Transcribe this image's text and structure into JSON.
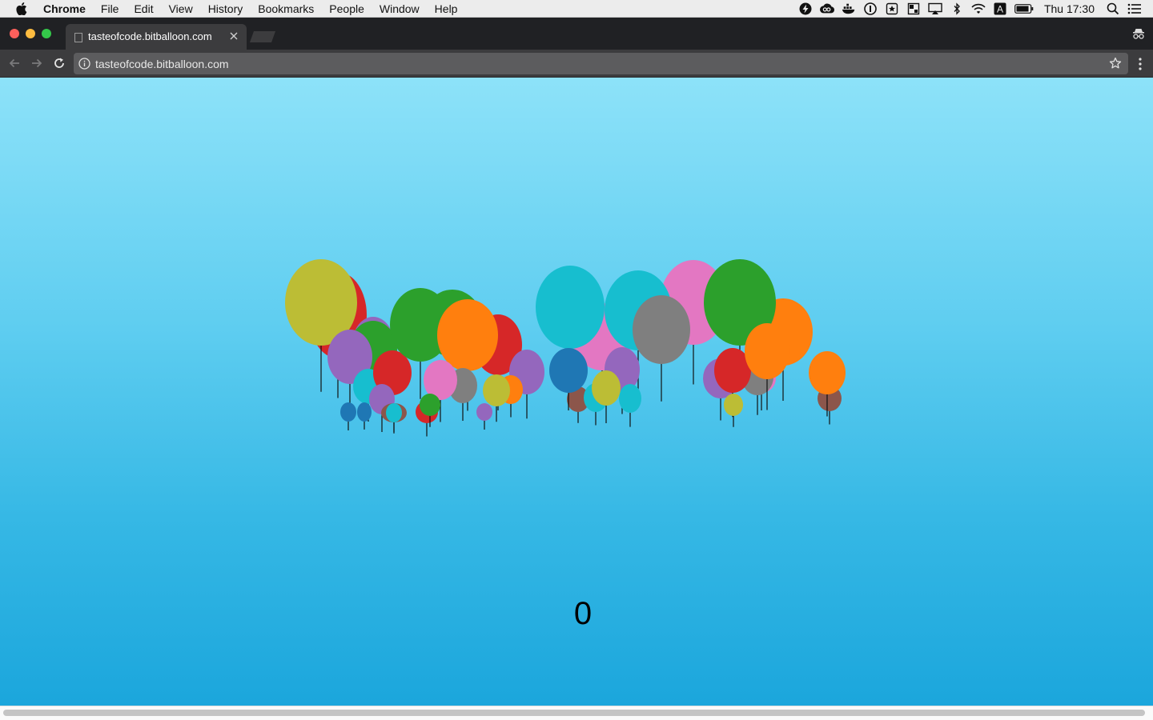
{
  "menubar": {
    "app_name": "Chrome",
    "items": [
      "File",
      "Edit",
      "View",
      "History",
      "Bookmarks",
      "People",
      "Window",
      "Help"
    ],
    "status_icons": [
      "bolt-icon",
      "creative-cloud-icon",
      "docker-icon",
      "1password-icon",
      "bookmark-app-icon",
      "grid-app-icon",
      "airplay-icon",
      "bluetooth-icon",
      "wifi-icon",
      "input-source-icon",
      "battery-icon"
    ],
    "input_source": "A",
    "clock": "Thu 17:30"
  },
  "browser": {
    "tab_title": "tasteofcode.bitballoon.com",
    "url": "tasteofcode.bitballoon.com"
  },
  "game": {
    "score": "0",
    "palette": {
      "olive": "#bcbd35",
      "red": "#d62728",
      "purple": "#9467bd",
      "green": "#2ca02c",
      "orange": "#ff7f0e",
      "cyan": "#17becf",
      "pink": "#e377c2",
      "gray": "#7f7f7f",
      "blue": "#1f77b4",
      "brown": "#8c564b"
    },
    "balloons": [
      {
        "color": "red"
      },
      {
        "color": "olive"
      },
      {
        "color": "purple"
      },
      {
        "color": "green"
      },
      {
        "color": "purple"
      },
      {
        "color": "cyan"
      },
      {
        "color": "red"
      },
      {
        "color": "green"
      },
      {
        "color": "green"
      },
      {
        "color": "red"
      },
      {
        "color": "orange"
      },
      {
        "color": "gray"
      },
      {
        "color": "pink"
      },
      {
        "color": "purple"
      },
      {
        "color": "orange"
      },
      {
        "color": "olive"
      },
      {
        "color": "purple"
      },
      {
        "color": "blue"
      },
      {
        "color": "blue"
      },
      {
        "color": "purple"
      },
      {
        "color": "brown"
      },
      {
        "color": "cyan"
      },
      {
        "color": "red"
      },
      {
        "color": "green"
      },
      {
        "color": "pink"
      },
      {
        "color": "cyan"
      },
      {
        "color": "pink"
      },
      {
        "color": "cyan"
      },
      {
        "color": "brown"
      },
      {
        "color": "purple"
      },
      {
        "color": "blue"
      },
      {
        "color": "cyan"
      },
      {
        "color": "cyan"
      },
      {
        "color": "olive"
      },
      {
        "color": "gray"
      },
      {
        "color": "pink"
      },
      {
        "color": "purple"
      },
      {
        "color": "gray"
      },
      {
        "color": "orange"
      },
      {
        "color": "green"
      },
      {
        "color": "red"
      },
      {
        "color": "orange"
      },
      {
        "color": "olive"
      },
      {
        "color": "brown"
      },
      {
        "color": "orange"
      }
    ]
  }
}
